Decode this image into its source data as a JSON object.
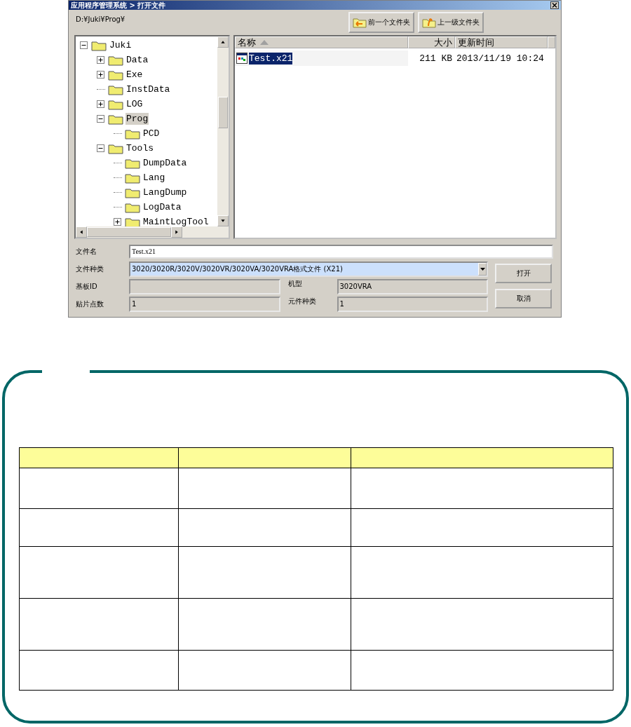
{
  "window": {
    "title": "应用程序管理系统 > 打开文件"
  },
  "path": "D:¥Juki¥Prog¥",
  "toolbar": [
    {
      "label": "前一个文件夹",
      "kind": "back"
    },
    {
      "label": "上一级文件夹",
      "kind": "up"
    }
  ],
  "tree": [
    {
      "label": "Juki",
      "expanded": true,
      "selected": false,
      "children": [
        {
          "label": "Data",
          "expanded": false,
          "selected": false
        },
        {
          "label": "Exe",
          "expanded": false,
          "selected": false
        },
        {
          "label": "InstData",
          "selected": false
        },
        {
          "label": "LOG",
          "expanded": false,
          "selected": false
        },
        {
          "label": "Prog",
          "expanded": true,
          "selected": true,
          "children": [
            {
              "label": "PCD",
              "selected": false
            }
          ]
        },
        {
          "label": "Tools",
          "expanded": true,
          "selected": false,
          "children": [
            {
              "label": "DumpData",
              "selected": false
            },
            {
              "label": "Lang",
              "selected": false
            },
            {
              "label": "LangDump",
              "selected": false
            },
            {
              "label": "LogData",
              "selected": false
            },
            {
              "label": "MaintLogTool",
              "expanded": false,
              "selected": false
            }
          ]
        }
      ]
    }
  ],
  "file_list": {
    "columns": [
      {
        "label": "名称",
        "sorted": true
      },
      {
        "label": "大小",
        "sorted": false
      },
      {
        "label": "更新时间",
        "sorted": false
      }
    ],
    "rows": [
      {
        "name": "Test.x21",
        "size": "211 KB",
        "modified": "2013/11/19 10:24",
        "selected": true
      }
    ]
  },
  "form": {
    "file_name": {
      "label": "文件名",
      "value": "Test.x21"
    },
    "file_type": {
      "label": "文件种类",
      "value": "3020/3020R/3020V/3020VR/3020VA/3020VRA格式文件 (X21)"
    },
    "board_id": {
      "label": "基板ID"
    },
    "model": {
      "label": "机型",
      "value": "3020VRA"
    },
    "placement_points": {
      "label": "贴片点数",
      "value": "1"
    },
    "component_types": {
      "label": "元件种类",
      "value": "1"
    }
  },
  "buttons": [
    "打开",
    "取消"
  ]
}
